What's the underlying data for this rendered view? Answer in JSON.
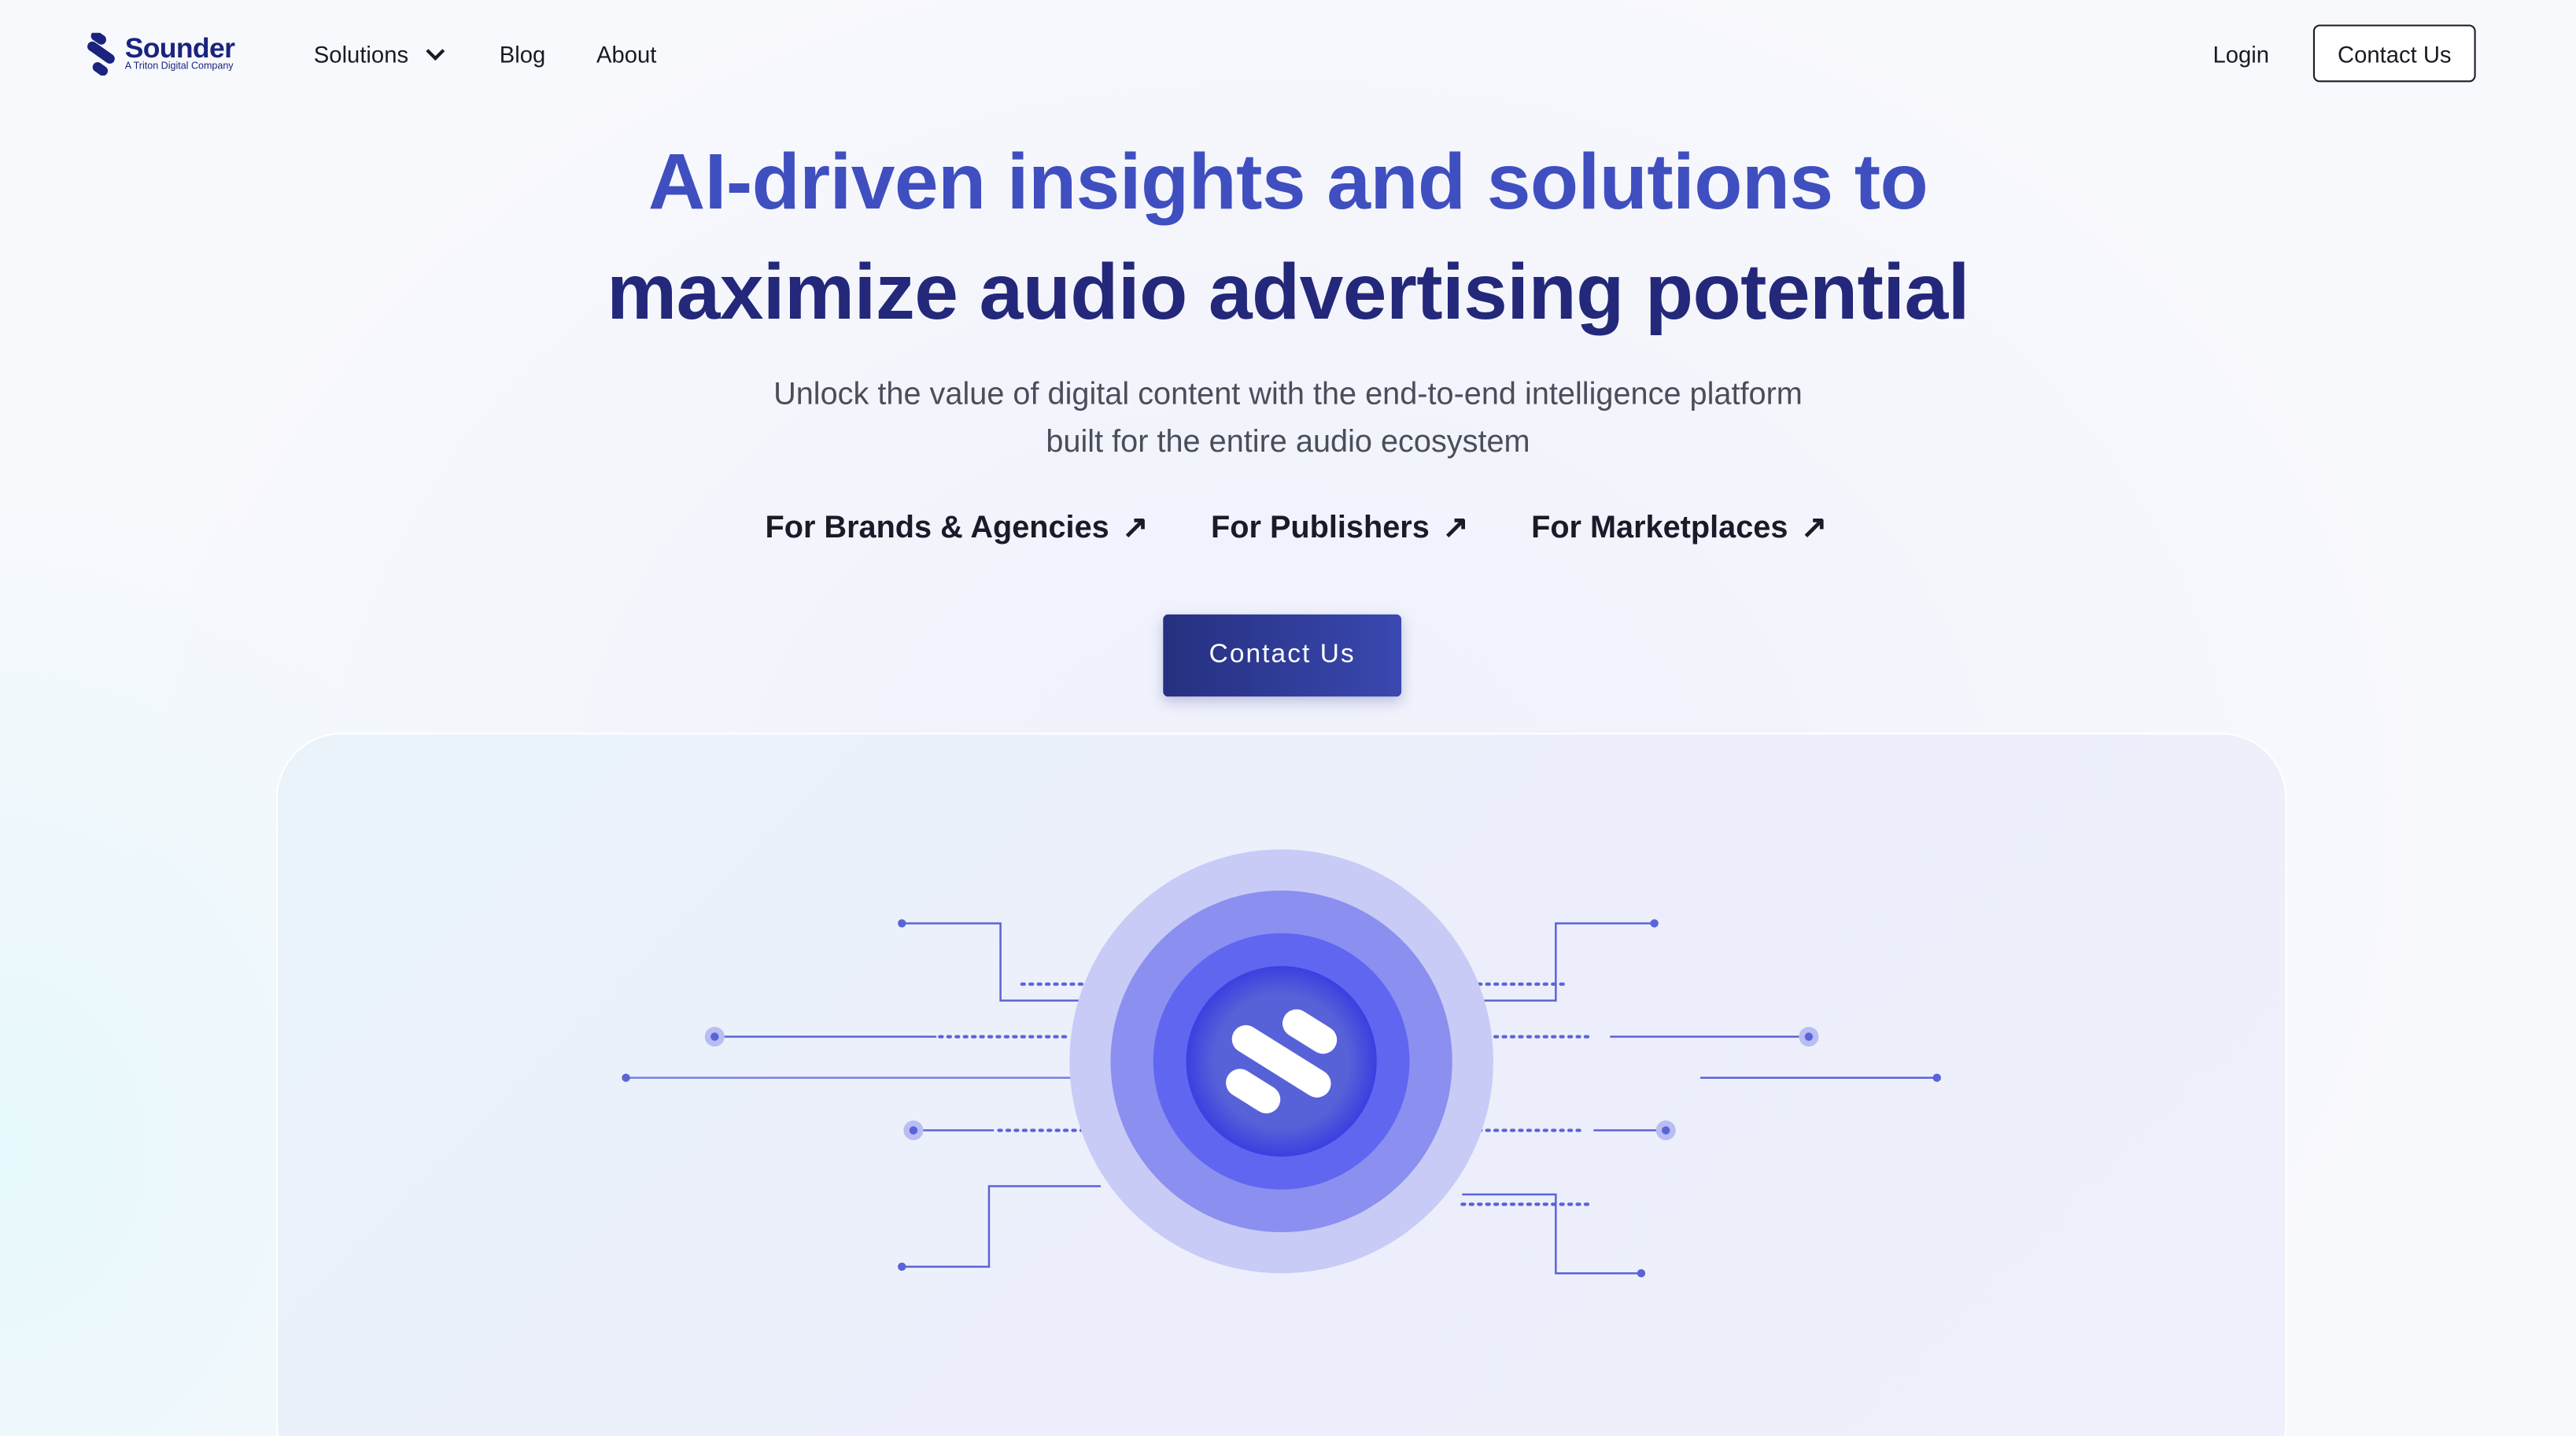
{
  "nav": {
    "logo": {
      "name": "Sounder",
      "tagline": "A Triton Digital Company"
    },
    "items": [
      {
        "label": "Solutions"
      },
      {
        "label": "Blog"
      },
      {
        "label": "About"
      }
    ],
    "login": "Login",
    "contact": "Contact Us"
  },
  "hero": {
    "title_line1": "AI-driven insights and solutions to",
    "title_line2": "maximize audio advertising potential",
    "subtitle_line1": "Unlock the value of digital content with the end-to-end intelligence platform",
    "subtitle_line2": "built for the entire audio ecosystem",
    "links": [
      {
        "label": "For Brands & Agencies"
      },
      {
        "label": "For Publishers"
      },
      {
        "label": "For Marketplaces"
      }
    ],
    "cta": "Contact Us"
  },
  "colors": {
    "brand": "#1a237e",
    "accent": "#5b63ec",
    "title_light": "#3f4fc0"
  }
}
